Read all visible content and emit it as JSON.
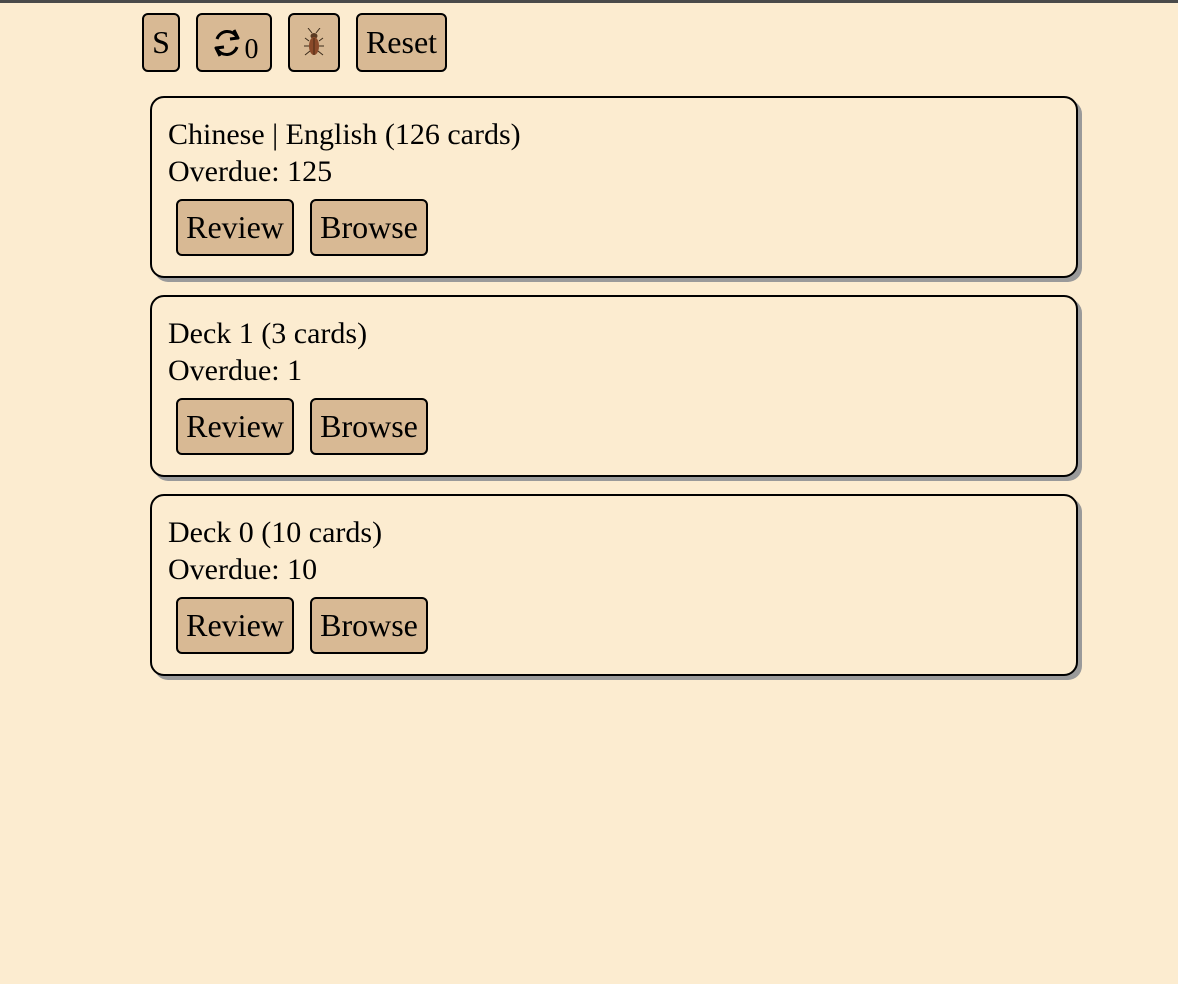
{
  "toolbar": {
    "settings_label": "S",
    "sync_icon": "sync-icon",
    "sync_count": "0",
    "bug_icon": "cockroach-icon",
    "reset_label": "Reset"
  },
  "decks": [
    {
      "title": "Chinese | English (126 cards)",
      "overdue": "Overdue: 125",
      "review_label": "Review",
      "browse_label": "Browse"
    },
    {
      "title": "Deck 1 (3 cards)",
      "overdue": "Overdue: 1",
      "review_label": "Review",
      "browse_label": "Browse"
    },
    {
      "title": "Deck 0 (10 cards)",
      "overdue": "Overdue: 10",
      "review_label": "Review",
      "browse_label": "Browse"
    }
  ],
  "colors": {
    "background": "#fcecd0",
    "button": "#d8b994",
    "border": "#000000"
  }
}
